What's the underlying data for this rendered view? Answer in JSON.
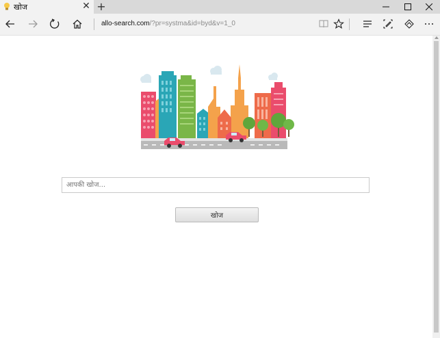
{
  "browser": {
    "tab": {
      "title": "खोज",
      "favicon": "lightbulb-icon"
    },
    "address_bar": {
      "host": "allo-search.com",
      "path": "/?pr=systma&id=byd&v=1_0"
    },
    "toolbar_icons": [
      "back-arrow-icon",
      "forward-arrow-icon",
      "refresh-icon",
      "home-icon",
      "reading-view-icon",
      "favorite-star-icon",
      "hub-icon",
      "web-note-icon",
      "share-icon",
      "more-icon"
    ],
    "window_controls": [
      "minimize-icon",
      "maximize-icon",
      "close-icon"
    ]
  },
  "page": {
    "illustration": "city-skyline-illustration",
    "search": {
      "placeholder": "आपकी खोज...",
      "value": ""
    },
    "search_button_label": "खोज"
  },
  "colors": {
    "pink": "#ea4c6c",
    "orange": "#f4a24b",
    "teal": "#2aa6b6",
    "green": "#7ab648",
    "red_orange": "#ee6b4a",
    "road": "#b9b9b9",
    "tree": "#5fa63b"
  }
}
